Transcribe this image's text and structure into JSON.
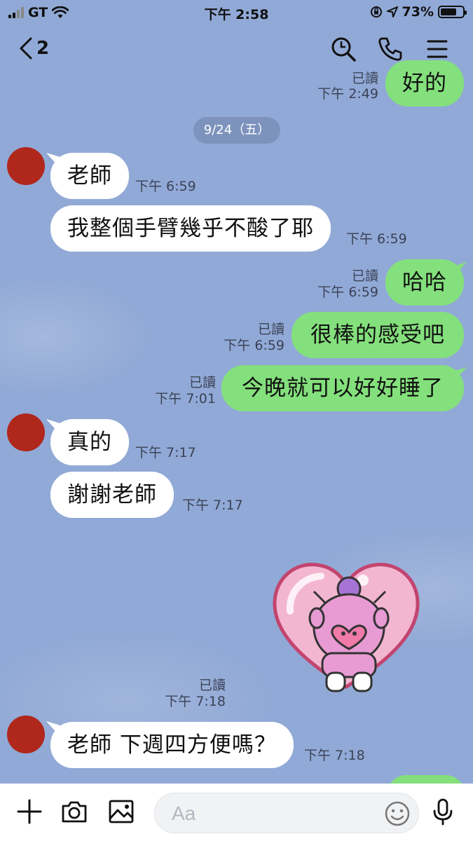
{
  "status_bar": {
    "carrier": "GT",
    "time": "下午 2:58",
    "battery": "73%",
    "battery_level": 0.73
  },
  "header": {
    "back_count": "2",
    "icons": [
      "search-icon",
      "phone-icon",
      "menu-icon"
    ]
  },
  "date_separator": "9/24（五）",
  "messages": [
    {
      "side": "out",
      "text": "好的",
      "read": "已讀",
      "time": "下午 2:49"
    },
    {
      "side": "in",
      "text": "老師",
      "time": "下午 6:59"
    },
    {
      "side": "in",
      "text": "我整個手臂幾乎不酸了耶",
      "time": "下午 6:59"
    },
    {
      "side": "out",
      "text": "哈哈",
      "read": "已讀",
      "time": "下午 6:59"
    },
    {
      "side": "out",
      "text": "很棒的感受吧",
      "read": "已讀",
      "time": "下午 6:59"
    },
    {
      "side": "out",
      "text": "今晚就可以好好睡了",
      "read": "已讀",
      "time": "下午 7:01"
    },
    {
      "side": "in",
      "text": "真的",
      "time": "下午 7:17"
    },
    {
      "side": "in",
      "text": "謝謝老師",
      "time": "下午 7:17"
    },
    {
      "side": "out",
      "type": "sticker",
      "sticker": "pink-character-heart-sticker",
      "read": "已讀",
      "time": "下午 7:18"
    },
    {
      "side": "in",
      "text": "老師 下週四方便嗎？",
      "time": "下午 7:18"
    }
  ],
  "composer": {
    "placeholder": "Aa",
    "icons": [
      "plus-icon",
      "camera-icon",
      "image-icon",
      "emoji-icon",
      "microphone-icon"
    ]
  },
  "colors": {
    "background": "#91a9d6",
    "outgoing_bubble": "#84e07c",
    "incoming_bubble": "#ffffff",
    "avatar": "#b0271c"
  }
}
